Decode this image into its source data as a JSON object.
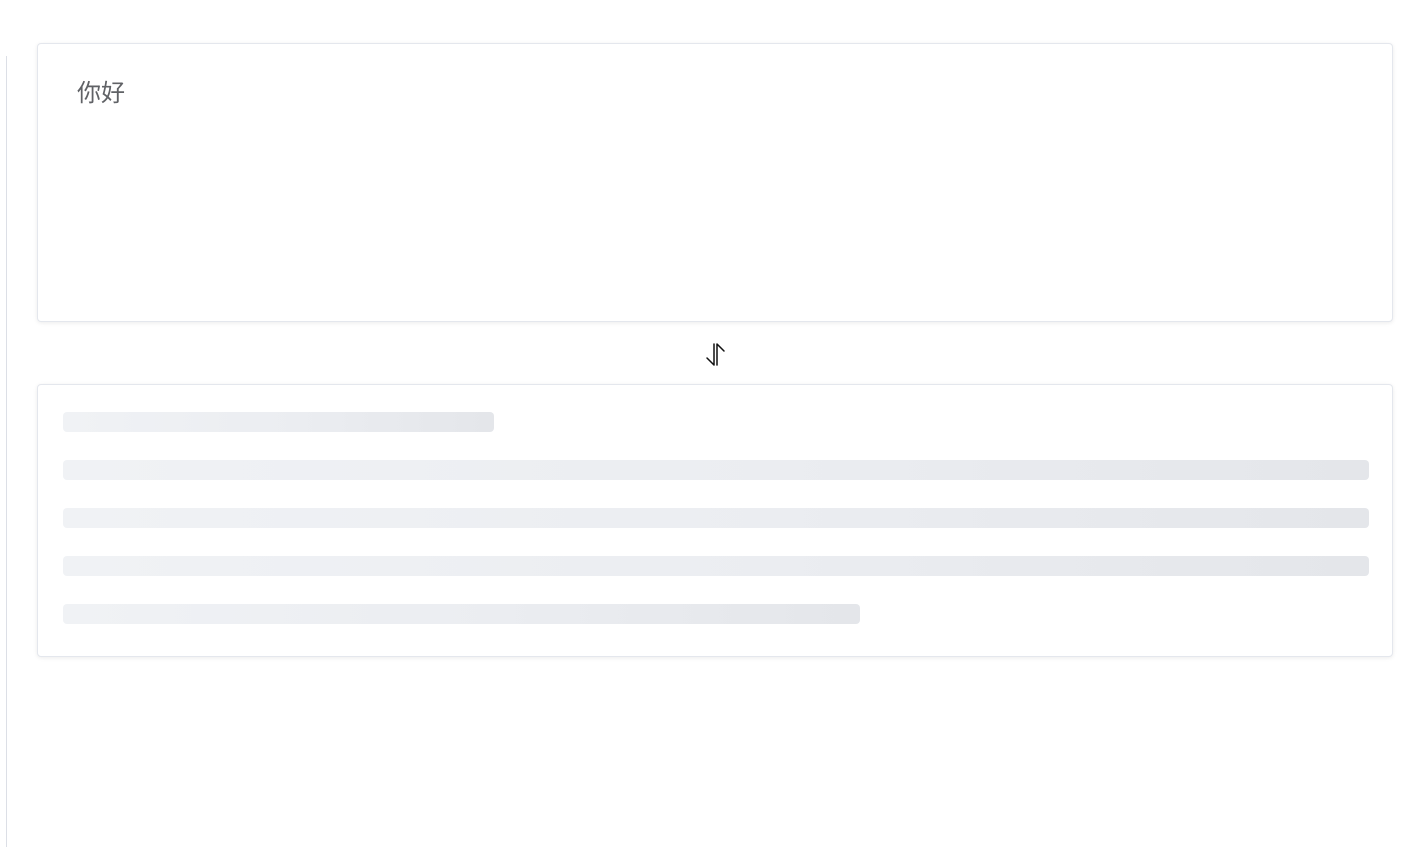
{
  "source": {
    "text": "你好"
  },
  "swap": {
    "icon": "swap-vertical-icon"
  },
  "result": {
    "state": "loading",
    "skeleton_rows": 5
  },
  "colors": {
    "card_border": "#e4e7ed",
    "skeleton_start": "#f0f2f5",
    "skeleton_end": "#e4e6ea",
    "text": "#606266"
  }
}
